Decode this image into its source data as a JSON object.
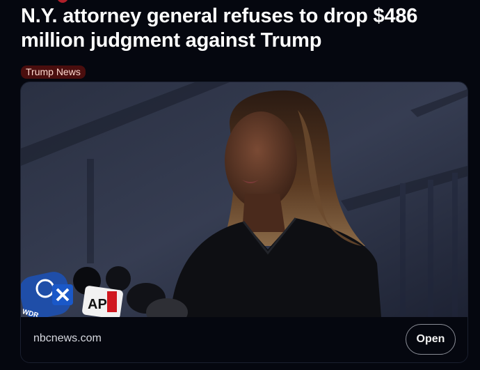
{
  "article": {
    "title": "N.Y. attorney general refuses to drop $486 million judgment against Trump",
    "tag": "Trump News",
    "source": "nbcnews.com",
    "open_label": "Open"
  },
  "photo": {
    "mic_logos": [
      "AP",
      "WDR"
    ]
  },
  "colors": {
    "background": "#05070f",
    "tag_bg": "#4a0e0e",
    "tag_text": "#ffd9cf",
    "button_border": "#8a8d96"
  }
}
